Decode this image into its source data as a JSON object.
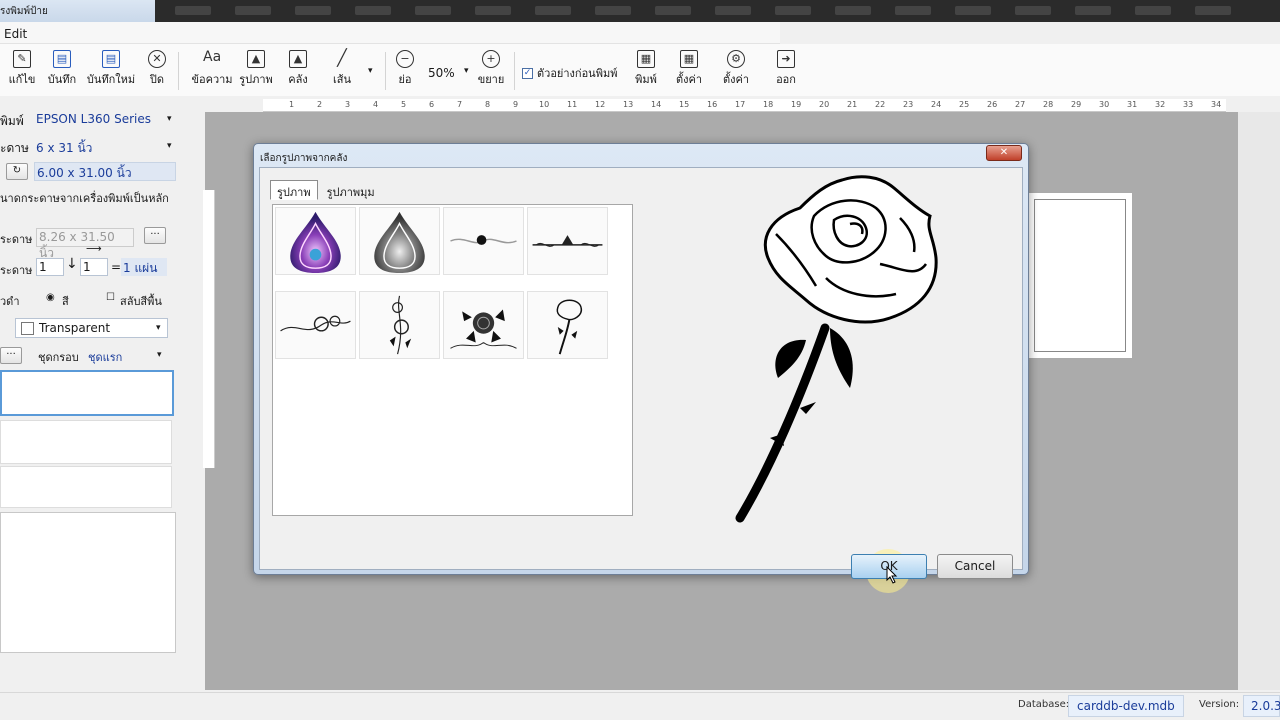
{
  "titlebar": {
    "title": "รงพิมพ์ป้าย"
  },
  "menu": {
    "edit": "Edit"
  },
  "toolbar": {
    "edit": "แก้ไข",
    "save": "บันทึก",
    "save_new": "บันทึกใหม่",
    "close": "ปิด",
    "text": "ข้อความ",
    "image": "รูปภาพ",
    "library": "คลัง",
    "line": "เส้น",
    "zoom_out": "ย่อ",
    "zoom_value": "50%",
    "zoom_in": "ขยาย",
    "preview_checkbox": "ตัวอย่างก่อนพิมพ์",
    "print": "พิมพ์",
    "print_setup": "ตั้งค่า",
    "settings": "ตั้งค่า",
    "exit": "ออก"
  },
  "left_panel": {
    "printer_label": "พิมพ์",
    "printer_value": "EPSON L360 Series",
    "paper_label": "ะดาษ",
    "paper_value": "6 x 31 นิ้ว",
    "custom_size_value": "6.00 x 31.00 นิ้ว",
    "from_printer_note": "นาดกระดาษจากเครื่องพิมพ์เป็นหลัก",
    "paper2_label": "ระดาษ",
    "paper2_value": "8.26 x 31.50 นิ้ว",
    "count_label": "ระดาษ",
    "count_a": "1",
    "count_b": "1",
    "count_result": "1 แผ่น",
    "color_label": "วดำ",
    "color_option": "สี",
    "swap_bg": "สลับสีพื้น",
    "background_value": "Transparent",
    "frame_label": "ชุดกรอบ",
    "frame_value": "ชุดแรก"
  },
  "ruler": {
    "ticks": [
      "1",
      "2",
      "3",
      "4",
      "5",
      "6",
      "7",
      "8",
      "9",
      "10",
      "11",
      "12",
      "13",
      "14",
      "15",
      "16",
      "17",
      "18",
      "19",
      "20",
      "21",
      "22",
      "23",
      "24",
      "25",
      "26",
      "27",
      "28",
      "29",
      "30",
      "31",
      "32",
      "33",
      "34"
    ]
  },
  "dialog": {
    "title": "เลือกรูปภาพจากคลัง",
    "tabs": [
      "รูปภาพ",
      "รูปภาพมุม"
    ],
    "thumbnails": [
      "purple-teardrop-ornament",
      "gray-teardrop-ornament",
      "swirl-divider",
      "ornament-divider",
      "rose-vine",
      "rose-vertical",
      "rose-bouquet",
      "single-rose"
    ],
    "ok": "OK",
    "cancel": "Cancel"
  },
  "statusbar": {
    "database_label": "Database:",
    "database_value": "carddb-dev.mdb",
    "version_label": "Version:",
    "version_value": "2.0.3"
  }
}
